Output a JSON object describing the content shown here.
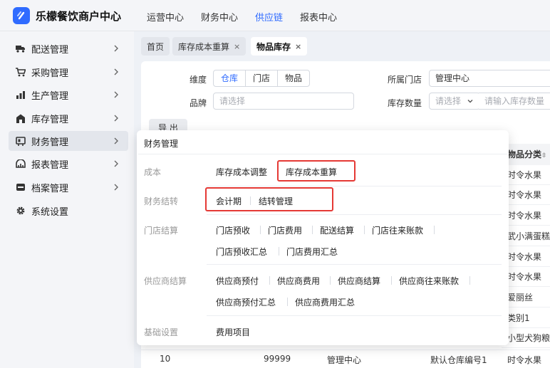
{
  "brand": {
    "title": "乐檬餐饮商户中心"
  },
  "topnav": [
    "运营中心",
    "财务中心",
    "供应链",
    "报表中心"
  ],
  "sidebar": [
    {
      "label": "配送管理",
      "icon": "truck-icon"
    },
    {
      "label": "采购管理",
      "icon": "cart-icon"
    },
    {
      "label": "生产管理",
      "icon": "bar-chart-icon"
    },
    {
      "label": "库存管理",
      "icon": "warehouse-icon"
    },
    {
      "label": "财务管理",
      "icon": "ledger-icon"
    },
    {
      "label": "报表管理",
      "icon": "report-icon"
    },
    {
      "label": "档案管理",
      "icon": "archive-icon"
    },
    {
      "label": "系统设置",
      "icon": "gear-icon"
    }
  ],
  "tabs": [
    {
      "label": "首页"
    },
    {
      "label": "库存成本重算",
      "close": "×"
    },
    {
      "label": "物品库存",
      "close": "×"
    }
  ],
  "filters": {
    "dimension_label": "维度",
    "dimension_options": [
      "仓库",
      "门店",
      "物品"
    ],
    "brand_label": "品牌",
    "brand_placeholder": "请选择",
    "store_label": "所属门店",
    "store_value": "管理中心",
    "qty_label": "库存数量",
    "qty_select_placeholder": "请选择",
    "qty_input_placeholder": "请输入库存数量",
    "export_label": "导 出"
  },
  "table": {
    "visible_header": "物品分类",
    "visible_cells": [
      "时令水果",
      "时令水果",
      "时令水果",
      "武小满蛋糕",
      "时令水果",
      "时令水果",
      "爱丽丝",
      "类别1",
      "小型犬狗粮"
    ],
    "last_row": {
      "index": "10",
      "code": "99999",
      "store": "管理中心",
      "warehouse": "默认仓库编号1",
      "category": "时令水果"
    }
  },
  "flyout": {
    "title": "财务管理",
    "groups": [
      {
        "label": "成本",
        "items": [
          "库存成本调整",
          "库存成本重算"
        ]
      },
      {
        "label": "财务结转",
        "items": [
          "会计期",
          "结转管理"
        ]
      },
      {
        "label": "门店结算",
        "items": [
          "门店预收",
          "门店费用",
          "配送结算",
          "门店往来账款",
          "门店预收汇总",
          "门店费用汇总"
        ]
      },
      {
        "label": "供应商结算",
        "items": [
          "供应商预付",
          "供应商费用",
          "供应商结算",
          "供应商往来账款",
          "供应商预付汇总",
          "供应商费用汇总"
        ]
      },
      {
        "label": "基础设置",
        "items": [
          "费用项目"
        ]
      }
    ]
  },
  "colors": {
    "accent": "#2f6bff",
    "highlight": "#e53935"
  }
}
